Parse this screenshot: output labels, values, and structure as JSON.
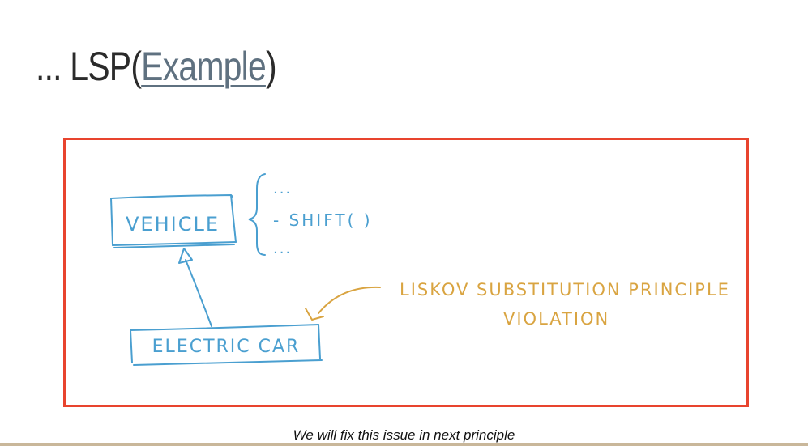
{
  "slide": {
    "title_prefix": "... LSP(",
    "title_link": "Example",
    "title_suffix": ")"
  },
  "diagram": {
    "class_parent": "VEHICLE",
    "class_child": "ELECTRIC CAR",
    "methods": [
      "...",
      "- SHIFT( )",
      "..."
    ],
    "annotation_line1": "LISKOV SUBSTITUTION PRINCIPLE",
    "annotation_line2": "VIOLATION"
  },
  "caption": "We will fix this issue in next principle",
  "colors": {
    "frame_border": "#e8442e",
    "sketch_blue": "#4a9fd0",
    "sketch_orange": "#d9a441",
    "link": "#5f7180"
  }
}
